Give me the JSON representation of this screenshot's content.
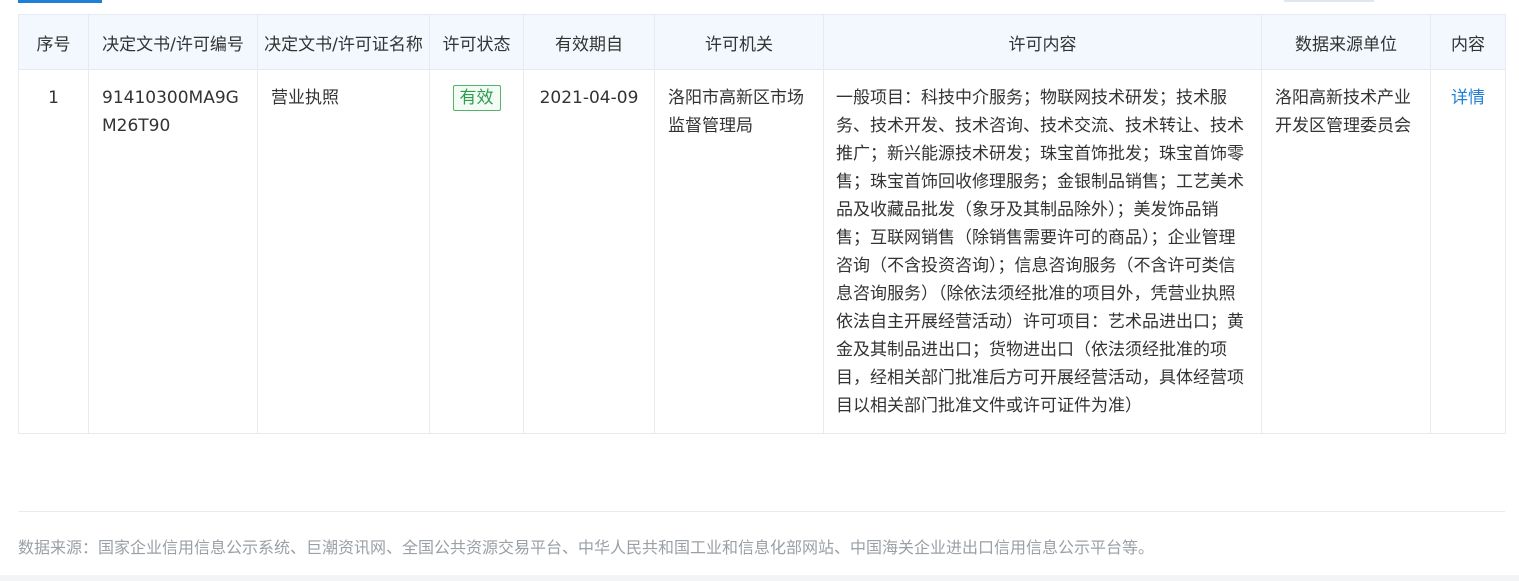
{
  "table": {
    "headers": [
      "序号",
      "决定文书/许可编号",
      "决定文书/许可证名称",
      "许可状态",
      "有效期自",
      "许可机关",
      "许可内容",
      "数据来源单位",
      "内容"
    ],
    "rows": [
      {
        "index": "1",
        "license_no": "91410300MA9GM26T90",
        "license_name": "营业执照",
        "status": "有效",
        "valid_from": "2021-04-09",
        "authority": "洛阳市高新区市场监督管理局",
        "content": "一般项目：科技中介服务；物联网技术研发；技术服务、技术开发、技术咨询、技术交流、技术转让、技术推广；新兴能源技术研发；珠宝首饰批发；珠宝首饰零售；珠宝首饰回收修理服务；金银制品销售；工艺美术品及收藏品批发（象牙及其制品除外）；美发饰品销售；互联网销售（除销售需要许可的商品）；企业管理咨询（不含投资咨询）；信息咨询服务（不含许可类信息咨询服务）（除依法须经批准的项目外，凭营业执照依法自主开展经营活动）许可项目：艺术品进出口；黄金及其制品进出口；货物进出口（依法须经批准的项目，经相关部门批准后方可开展经营活动，具体经营项目以相关部门批准文件或许可证件为准）",
        "source_unit": "洛阳高新技术产业开发区管理委员会",
        "detail_label": "详情"
      }
    ]
  },
  "footer": {
    "source_note": "数据来源：国家企业信用信息公示系统、巨潮资讯网、全国公共资源交易平台、中华人民共和国工业和信息化部网站、中国海关企业进出口信用信息公示平台等。"
  },
  "colors": {
    "header_bg": "#f2f8fe",
    "border": "#e6ebf2",
    "link": "#1e7fd8",
    "status_green": "#2f9b4f",
    "muted_text": "#9aa0a6"
  }
}
